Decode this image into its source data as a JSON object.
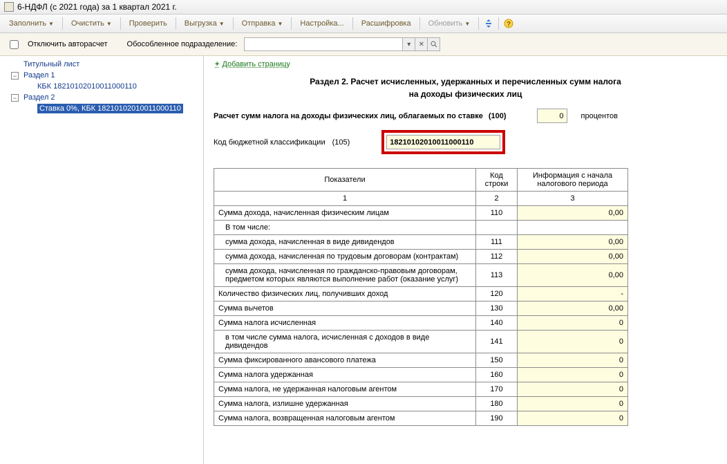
{
  "window": {
    "title": "6-НДФЛ (с 2021 года) за 1 квартал 2021 г."
  },
  "toolbar": {
    "fill": "Заполнить",
    "clear": "Очистить",
    "check": "Проверить",
    "export": "Выгрузка",
    "send": "Отправка",
    "settings": "Настройка...",
    "decode": "Расшифровка",
    "refresh": "Обновить"
  },
  "subbar": {
    "autorecalc": "Отключить авторасчет",
    "subdivision_label": "Обособленное подразделение:",
    "subdivision_value": ""
  },
  "tree": {
    "title_page": "Титульный лист",
    "section1": "Раздел 1",
    "section1_kbk": "КБК 18210102010011000110",
    "section2": "Раздел 2",
    "section2_rate": "Ставка 0%, КБК 18210102010011000110"
  },
  "main": {
    "add_page": "Добавить страницу",
    "section_title_1": "Раздел 2. Расчет исчисленных, удержанных и перечисленных сумм налога",
    "section_title_2": "на доходы физических лиц",
    "rate_line_label": "Расчет сумм налога на доходы физических лиц, облагаемых по ставке",
    "rate_line_code": "(100)",
    "rate_value": "0",
    "rate_suffix": "процентов",
    "kbk_label": "Код бюджетной классификации",
    "kbk_code": "(105)",
    "kbk_value": "18210102010011000110",
    "th_indicator": "Показатели",
    "th_code": "Код строки",
    "th_info": "Информация с начала налогового периода",
    "colnums": [
      "1",
      "2",
      "3"
    ],
    "rows": [
      {
        "label": "Сумма дохода, начисленная физическим лицам",
        "code": "110",
        "val": "0,00",
        "indent": 0
      },
      {
        "label": "В том числе:",
        "code": "",
        "val": "",
        "indent": 1,
        "novalue": true
      },
      {
        "label": "сумма дохода, начисленная в виде дивидендов",
        "code": "111",
        "val": "0,00",
        "indent": 1
      },
      {
        "label": "сумма дохода, начисленная по трудовым договорам (контрактам)",
        "code": "112",
        "val": "0,00",
        "indent": 1
      },
      {
        "label": "сумма дохода, начисленная по гражданско-правовым договорам, предметом которых являются выполнение работ (оказание услуг)",
        "code": "113",
        "val": "0,00",
        "indent": 1
      },
      {
        "label": "Количество физических лиц, получивших доход",
        "code": "120",
        "val": "-",
        "indent": 0
      },
      {
        "label": "Сумма вычетов",
        "code": "130",
        "val": "0,00",
        "indent": 0
      },
      {
        "label": "Сумма налога исчисленная",
        "code": "140",
        "val": "0",
        "indent": 0
      },
      {
        "label": "в том числе сумма налога, исчисленная с доходов в виде дивидендов",
        "code": "141",
        "val": "0",
        "indent": 1
      },
      {
        "label": "Сумма фиксированного авансового платежа",
        "code": "150",
        "val": "0",
        "indent": 0
      },
      {
        "label": "Сумма налога удержанная",
        "code": "160",
        "val": "0",
        "indent": 0
      },
      {
        "label": "Сумма налога, не удержанная налоговым агентом",
        "code": "170",
        "val": "0",
        "indent": 0
      },
      {
        "label": "Сумма налога, излишне удержанная",
        "code": "180",
        "val": "0",
        "indent": 0
      },
      {
        "label": "Сумма налога, возвращенная налоговым агентом",
        "code": "190",
        "val": "0",
        "indent": 0
      }
    ]
  }
}
